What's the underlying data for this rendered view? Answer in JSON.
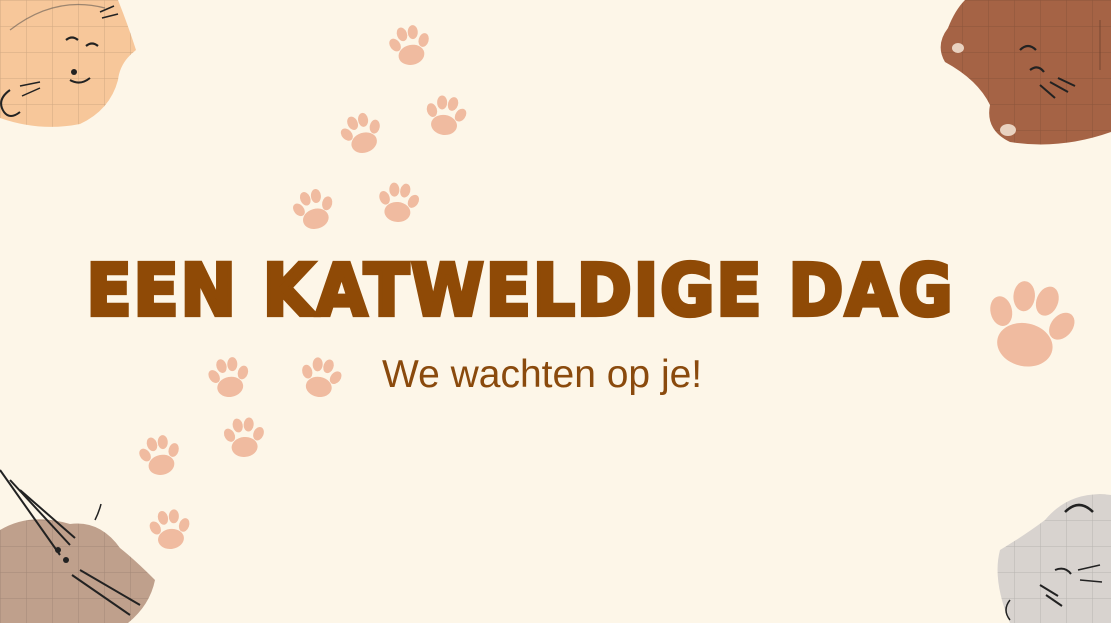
{
  "card": {
    "title": "EEN KATWELDIGE DAG",
    "subtitle": "We wachten op je!"
  },
  "colors": {
    "background": "#FDF6E8",
    "title": "#8F4A06",
    "subtitle": "#8A4A0D",
    "paw": "#F0BBA0",
    "cat_orange": "#F7C79A",
    "cat_brown": "#A56345",
    "cat_tan": "#BFA08C",
    "cat_gray": "#D8D3CF"
  },
  "decorations": {
    "paw_icon": "paw-print-icon",
    "cat_icon": "cat-face-icon"
  }
}
